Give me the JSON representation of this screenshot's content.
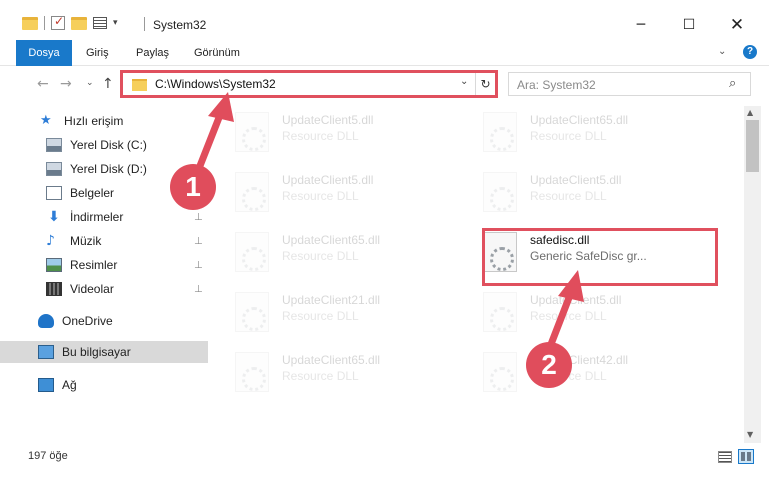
{
  "window": {
    "title": "System32",
    "minimize_glyph": "─",
    "maximize_glyph": "☐",
    "close_glyph": "✕"
  },
  "ribbon": {
    "tabs": [
      {
        "label": "Dosya",
        "active": true
      },
      {
        "label": "Giriş"
      },
      {
        "label": "Paylaş"
      },
      {
        "label": "Görünüm"
      }
    ],
    "expand_glyph": "⌄",
    "help_glyph": "?"
  },
  "navigation": {
    "back_glyph": "←",
    "forward_glyph": "→",
    "recent_glyph": "⌄",
    "up_glyph": "↑",
    "address": "C:\\Windows\\System32",
    "dropdown_glyph": "⌄",
    "refresh_glyph": "↻"
  },
  "search": {
    "placeholder": "Ara: System32",
    "icon": "search-icon",
    "glyph": "⌕"
  },
  "sidebar": {
    "items": [
      {
        "label": "Hızlı erişim",
        "icon": "star-icon",
        "glyph": "★"
      },
      {
        "label": "Yerel Disk (C:)",
        "icon": "drive-icon",
        "pinned": true
      },
      {
        "label": "Yerel Disk (D:)",
        "icon": "drive-icon",
        "pinned": true
      },
      {
        "label": "Belgeler",
        "icon": "documents-icon",
        "pinned": true
      },
      {
        "label": "İndirmeler",
        "icon": "downloads-icon",
        "glyph": "⬇",
        "pinned": true
      },
      {
        "label": "Müzik",
        "icon": "music-icon",
        "glyph": "♪",
        "pinned": true
      },
      {
        "label": "Resimler",
        "icon": "pictures-icon",
        "pinned": true
      },
      {
        "label": "Videolar",
        "icon": "videos-icon",
        "pinned": true
      },
      {
        "label": "OneDrive",
        "icon": "cloud-icon"
      },
      {
        "label": "Bu bilgisayar",
        "icon": "computer-icon",
        "selected": true
      },
      {
        "label": "Ağ",
        "icon": "network-icon"
      }
    ],
    "pin_glyph": "📌"
  },
  "files": [
    {
      "name": "UpdateClient5.dll",
      "desc": "Resource DLL",
      "faded": true
    },
    {
      "name": "UpdateClient65.dll",
      "desc": "Resource DLL",
      "faded": true
    },
    {
      "name": "UpdateClient5.dll",
      "desc": "Resource DLL",
      "faded": true
    },
    {
      "name": "UpdateClient5.dll",
      "desc": "Resource DLL",
      "faded": true
    },
    {
      "name": "UpdateClient65.dll",
      "desc": "Resource DLL",
      "faded": true
    },
    {
      "name": "safedisc.dll",
      "desc": "Generic SafeDisc gr...",
      "faded": false
    },
    {
      "name": "UpdateClient21.dll",
      "desc": "Resource DLL",
      "faded": true
    },
    {
      "name": "UpdateClient5.dll",
      "desc": "Resource DLL",
      "faded": true
    },
    {
      "name": "UpdateClient65.dll",
      "desc": "Resource DLL",
      "faded": true
    },
    {
      "name": "UpdateClient42.dll",
      "desc": "Resource DLL",
      "faded": true
    }
  ],
  "status": {
    "item_count": "197 öğe"
  },
  "scrollbar": {
    "up_glyph": "▲",
    "down_glyph": "▼"
  },
  "callouts": [
    {
      "number": "1",
      "target": "address-bar"
    },
    {
      "number": "2",
      "target": "safedisc.dll"
    }
  ],
  "colors": {
    "accent": "#1979ca",
    "callout": "#e04d5c",
    "selected_item": "#d9d9d9"
  }
}
